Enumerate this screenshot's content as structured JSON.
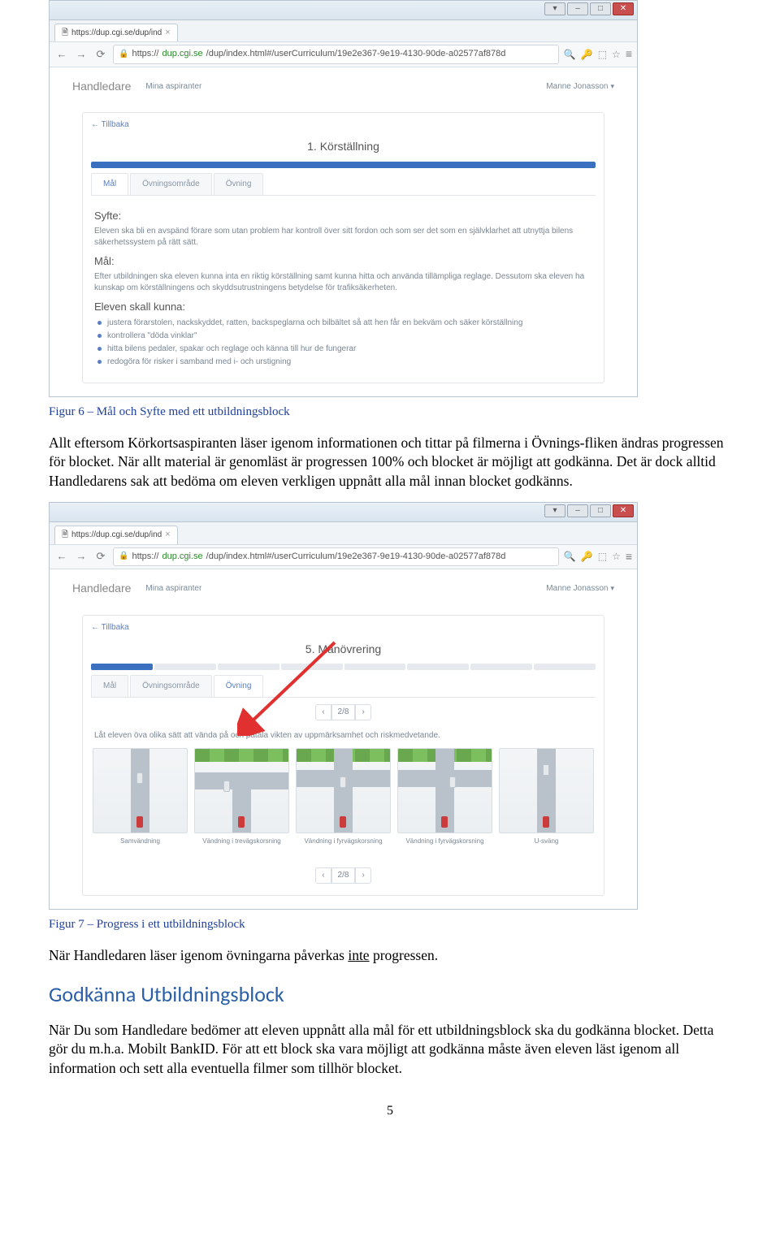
{
  "browser": {
    "tab_title": "https://dup.cgi.se/dup/ind",
    "url_scheme": "https://",
    "url_host": "dup.cgi.se",
    "url_path": "/dup/index.html#/userCurriculum/19e2e367-9e19-4130-90de-a02577af878d"
  },
  "page": {
    "brand": "Handledare",
    "sublink": "Mina aspiranter",
    "user": "Manne Jonasson",
    "back": "Tillbaka"
  },
  "shot1": {
    "title": "1. Körställning",
    "tabs": {
      "mal": "Mål",
      "omrade": "Övningsområde",
      "ovning": "Övning"
    },
    "syfte_h": "Syfte:",
    "syfte_p": "Eleven ska bli en avspänd förare som utan problem har kontroll över sitt fordon och som ser det som en självklarhet att utnyttja bilens säkerhetssystem på rätt sätt.",
    "mal_h": "Mål:",
    "mal_p": "Efter utbildningen ska eleven kunna inta en riktig körställning samt kunna hitta och använda tillämpliga reglage. Dessutom ska eleven ha kunskap om körställningens och skyddsutrustningens betydelse för trafiksäkerheten.",
    "kunna_h": "Eleven skall kunna:",
    "bullets": [
      "justera förarstolen, nackskyddet, ratten, backspeglarna och bilbältet så att hen får en bekväm och säker körställning",
      "kontrollera \"döda vinklar\"",
      "hitta bilens pedaler, spakar och reglage och känna till hur de fungerar",
      "redogöra för risker i samband med i- och urstigning"
    ]
  },
  "shot2": {
    "title": "5. Manövrering",
    "pager": "2/8",
    "instruct": "Låt eleven öva olika sätt att vända på och påtala vikten av uppmärksamhet och riskmedvetande.",
    "scenarios": [
      "Samvändning",
      "Vändning i trevägskorsning",
      "Vändning i fyrvägskorsning",
      "Vändning i fyrvägskorsning",
      "U-sväng"
    ]
  },
  "fig6": "Figur 6 – Mål och Syfte med ett utbildningsblock",
  "fig7": "Figur 7 – Progress i ett utbildningsblock",
  "body": {
    "p1": "Allt eftersom Körkortsaspiranten läser igenom informationen och tittar på filmerna i Övnings-fliken ändras progressen för blocket. När allt material är genomläst är progressen 100% och blocket är möjligt att godkänna. Det är dock alltid Handledarens sak att bedöma om eleven verkligen uppnått alla mål innan blocket godkänns.",
    "p2a": "När Handledaren läser igenom övningarna påverkas ",
    "p2u": "inte",
    "p2b": " progressen.",
    "h2": "Godkänna Utbildningsblock",
    "p3": "När Du som Handledare bedömer att eleven uppnått alla mål för ett utbildningsblock ska du godkänna blocket. Detta gör du m.h.a. Mobilt BankID. För att ett block ska vara möjligt att godkänna måste även eleven läst igenom all information och sett alla eventuella filmer som tillhör blocket."
  },
  "page_number": "5"
}
